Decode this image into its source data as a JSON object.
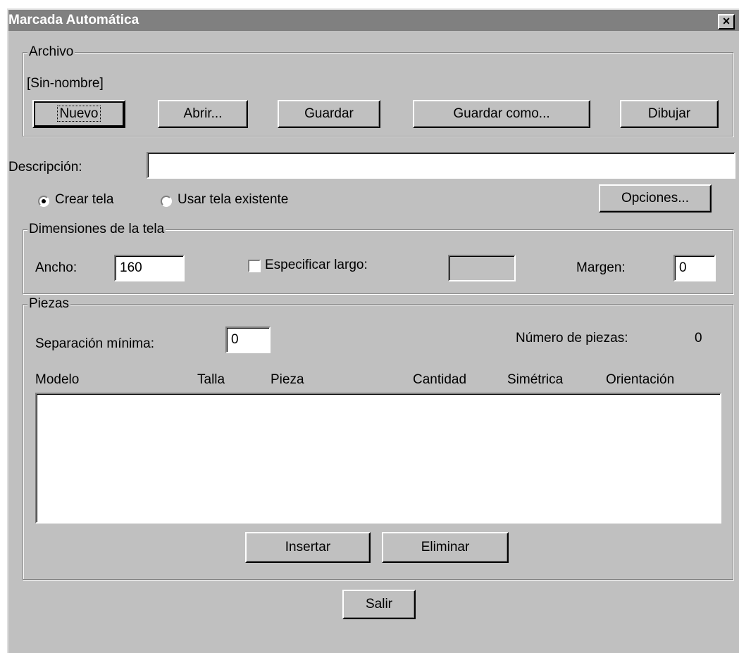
{
  "window": {
    "title": "Marcada Automática",
    "close_glyph": "×",
    "close_icon": "close-icon"
  },
  "archivo": {
    "legend": "Archivo",
    "filename": "[Sin-nombre]",
    "buttons": {
      "nuevo": "Nuevo",
      "abrir": "Abrir...",
      "guardar": "Guardar",
      "guardar_como": "Guardar como...",
      "dibujar": "Dibujar"
    }
  },
  "descripcion": {
    "label": "Descripción:",
    "value": ""
  },
  "tela": {
    "crear_label": "Crear tela",
    "usar_label": "Usar tela existente",
    "selected": "crear",
    "opciones_button": "Opciones..."
  },
  "dimensiones": {
    "legend": "Dimensiones de la tela",
    "ancho_label": "Ancho:",
    "ancho_value": "160",
    "especificar_label": "Especificar largo:",
    "especificar_checked": false,
    "largo_value": "",
    "margen_label": "Margen:",
    "margen_value": "0"
  },
  "piezas": {
    "legend": "Piezas",
    "separacion_label": "Separación mínima:",
    "separacion_value": "0",
    "numero_label": "Número de piezas:",
    "numero_value": "0",
    "columns": [
      "Modelo",
      "Talla",
      "Pieza",
      "Cantidad",
      "Simétrica",
      "Orientación"
    ],
    "rows": [],
    "insertar_button": "Insertar",
    "eliminar_button": "Eliminar"
  },
  "salir_button": "Salir"
}
